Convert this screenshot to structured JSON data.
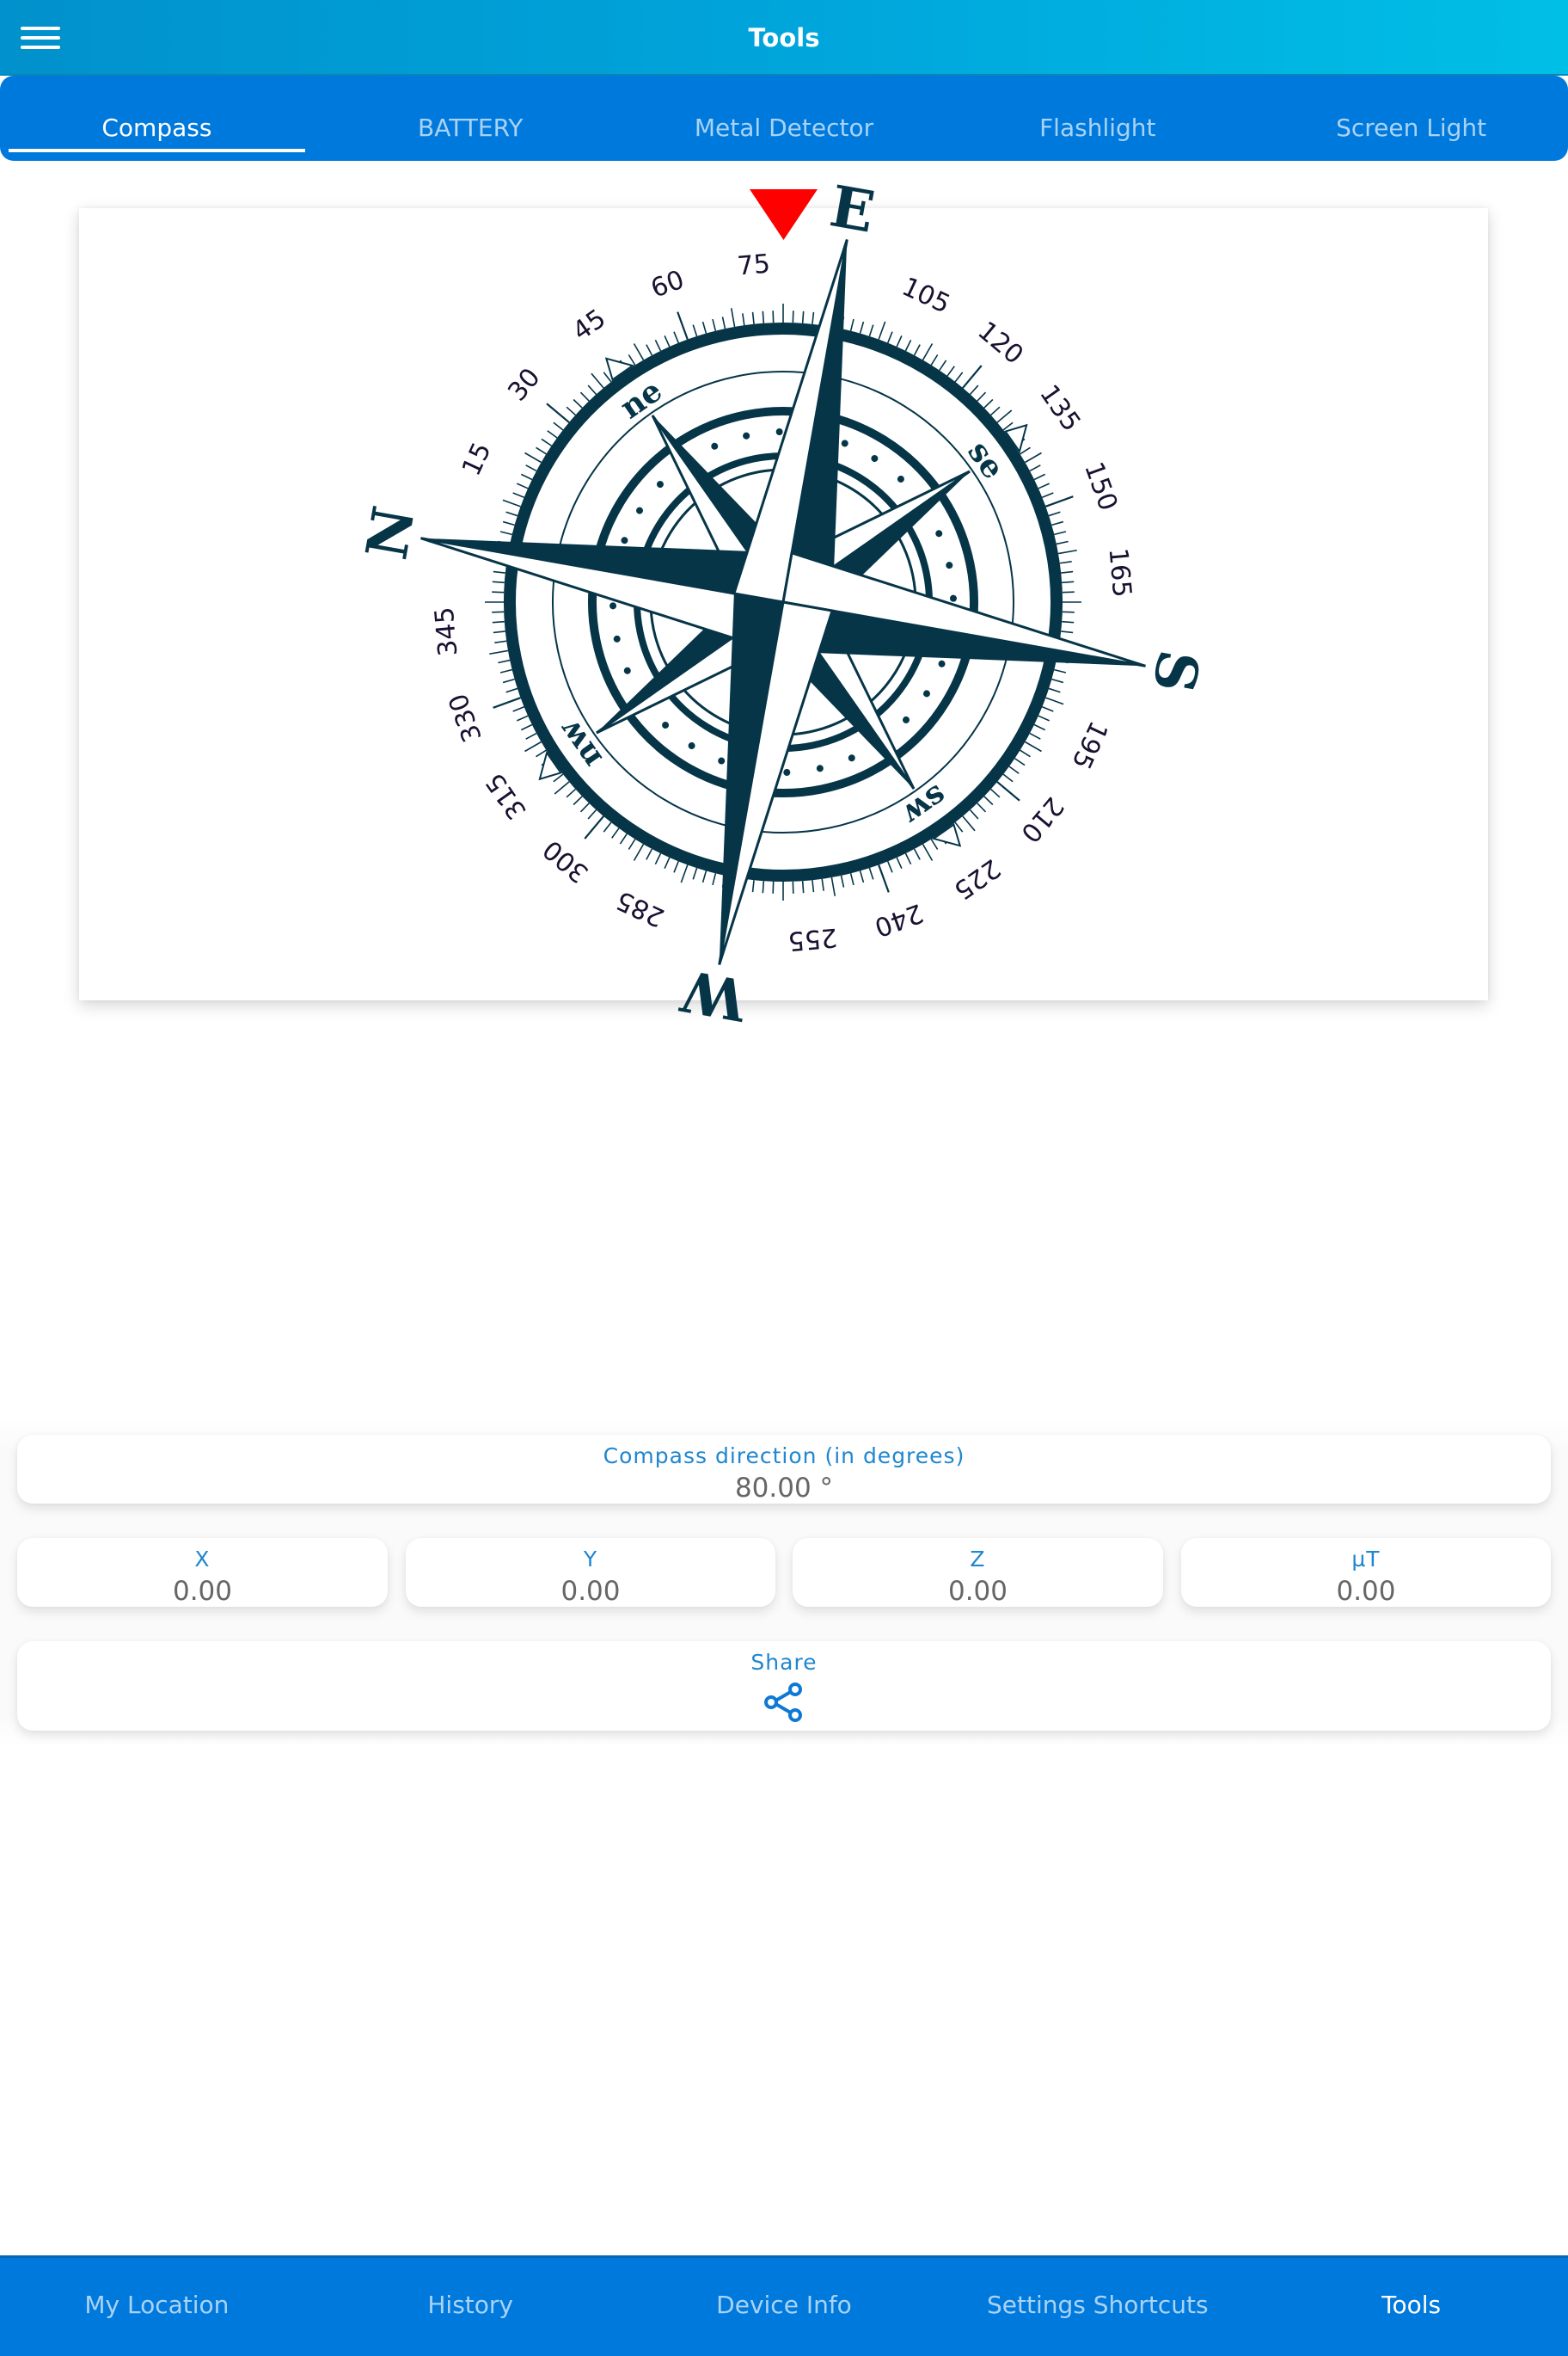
{
  "header": {
    "title": "Tools",
    "menu_icon": "hamburger-menu-icon"
  },
  "tabs": [
    {
      "label": "Compass",
      "active": true
    },
    {
      "label": "BATTERY",
      "active": false
    },
    {
      "label": "Metal Detector",
      "active": false
    },
    {
      "label": "Flashlight",
      "active": false
    },
    {
      "label": "Screen Light",
      "active": false
    }
  ],
  "compass": {
    "heading_deg": 80,
    "marker_icon": "heading-triangle-icon",
    "colors": {
      "rose": "#063548",
      "marker": "#ff0000",
      "numbers": "#1a1030"
    },
    "cardinals": [
      {
        "label": "N",
        "deg": 0
      },
      {
        "label": "E",
        "deg": 90
      },
      {
        "label": "S",
        "deg": 180
      },
      {
        "label": "W",
        "deg": 270
      }
    ],
    "intercardinals": [
      {
        "label": "ne",
        "deg": 45
      },
      {
        "label": "se",
        "deg": 135
      },
      {
        "label": "sw",
        "deg": 225
      },
      {
        "label": "nw",
        "deg": 315
      }
    ],
    "degree_labels": [
      "15",
      "30",
      "45",
      "60",
      "75",
      "105",
      "120",
      "135",
      "150",
      "165",
      "195",
      "210",
      "225",
      "240",
      "255",
      "285",
      "300",
      "315",
      "330",
      "345"
    ]
  },
  "readouts": {
    "direction": {
      "label": "Compass direction (in degrees)",
      "value": "80.00 °"
    },
    "x": {
      "label": "X",
      "value": "0.00"
    },
    "y": {
      "label": "Y",
      "value": "0.00"
    },
    "z": {
      "label": "Z",
      "value": "0.00"
    },
    "ut": {
      "label": "µT",
      "value": "0.00"
    },
    "share": {
      "label": "Share",
      "icon": "share-icon"
    }
  },
  "bottom_nav": [
    {
      "label": "My Location",
      "active": false
    },
    {
      "label": "History",
      "active": false
    },
    {
      "label": "Device Info",
      "active": false
    },
    {
      "label": "Settings Shortcuts",
      "active": false
    },
    {
      "label": "Tools",
      "active": true
    }
  ],
  "colors": {
    "header_start": "#0191cc",
    "header_end": "#00bfe6",
    "tab_bar": "#0079dc",
    "accent_text": "#1f86cf",
    "value_text": "#666666"
  }
}
